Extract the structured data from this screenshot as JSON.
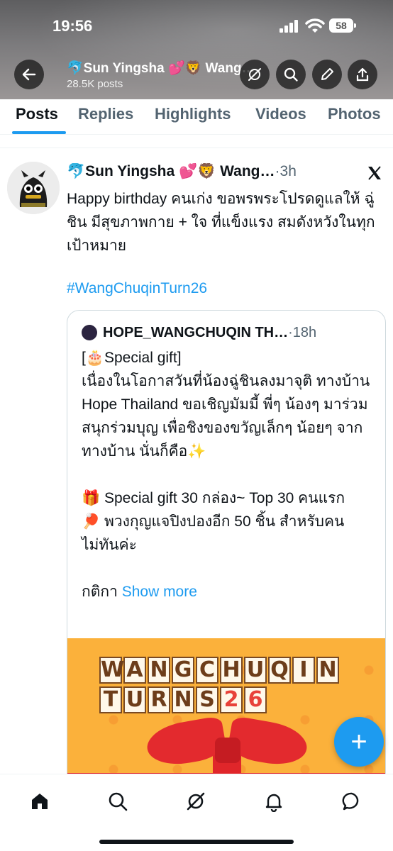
{
  "status_bar": {
    "time": "19:56",
    "battery": "58"
  },
  "header": {
    "name": "🐬Sun Yingsha 💕🦁 Wang…",
    "posts_count": "28.5K posts"
  },
  "tabs": [
    {
      "label": "Posts",
      "active": true
    },
    {
      "label": "Replies",
      "active": false
    },
    {
      "label": "Highlights",
      "active": false
    },
    {
      "label": "Videos",
      "active": false
    },
    {
      "label": "Photos",
      "active": false
    }
  ],
  "tweet": {
    "author": "🐬Sun Yingsha 💕🦁 Wang…",
    "time": "·3h",
    "text": "Happy birthday คนเก่ง ขอพรพระโปรดดูแลให้ ฉู่ชิน มีสุขภาพกาย + ใจ ที่แข็งแรง สมดังหวังในทุกเป้าหมาย",
    "hashtag": "#WangChuqinTurn26"
  },
  "quote": {
    "author": "HOPE_WANGCHUQIN TH…",
    "time": "·18h",
    "lines": [
      "[🎂Special gift]",
      "เนื่องในโอกาสวันที่น้องฉู่ชินลงมาจุติ ทางบ้าน Hope Thailand ขอเชิญมัมมี้ พี่ๆ น้องๆ มาร่วมสนุกร่วมบุญ เพื่อชิงของขวัญเล็กๆ น้อยๆ จากทางบ้าน นั่นก็คือ✨",
      "",
      "🎁 Special gift 30 กล่อง~ Top 30 คนแรก",
      "🏓 พวงกุญแจปิงปองอีก 50 ชิ้น สำหรับคนไม่ทันค่ะ",
      ""
    ],
    "last_line_prefix": "กติกา ",
    "show_more": "Show more",
    "image_line1": [
      "W",
      "A",
      "N",
      "G",
      "C",
      "H",
      "U",
      "Q",
      "I",
      "N"
    ],
    "image_line2": [
      "T",
      "U",
      "R",
      "N",
      "S",
      "2",
      "6"
    ]
  },
  "fab": {
    "icon": "+"
  },
  "colors": {
    "accent": "#1d9bf0",
    "text": "#0f1419",
    "muted": "#536471"
  }
}
